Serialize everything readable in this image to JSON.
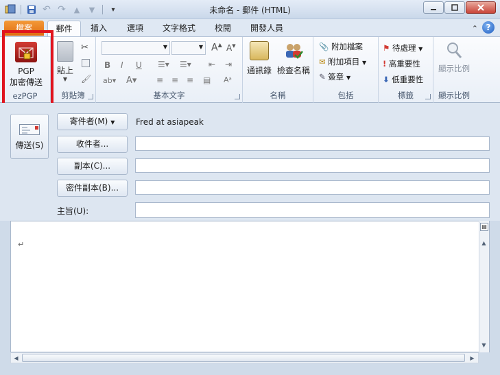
{
  "window": {
    "title": "未命名 - 郵件 (HTML)"
  },
  "tabs": {
    "file": "檔案",
    "items": [
      "郵件",
      "插入",
      "選項",
      "文字格式",
      "校閱",
      "開發人員"
    ],
    "active": "郵件"
  },
  "ribbon": {
    "ezpgp": {
      "button_line1": "PGP",
      "button_line2": "加密傳送",
      "group": "ezPGP"
    },
    "clipboard": {
      "paste": "貼上",
      "group": "剪貼簿"
    },
    "basictext": {
      "group": "基本文字"
    },
    "names": {
      "address_book": "通訊錄",
      "check_names": "檢查名稱",
      "group": "名稱"
    },
    "include": {
      "attach_file": "附加檔案",
      "attach_item": "附加項目",
      "signature": "簽章",
      "group": "包括"
    },
    "tags": {
      "follow_up": "待處理",
      "high_importance": "高重要性",
      "low_importance": "低重要性",
      "group": "標籤"
    },
    "zoom": {
      "label": "顯示比例",
      "group": "顯示比例"
    }
  },
  "compose": {
    "send": "傳送(S)",
    "from_button": "寄件者(M)",
    "from_value": "Fred at asiapeak",
    "to_button": "收件者...",
    "cc_button": "副本(C)...",
    "bcc_button": "密件副本(B)...",
    "subject_label": "主旨(U):",
    "body_cursor": "↵"
  },
  "colors": {
    "file_tab": "#e06a10",
    "highlight": "#e0141e",
    "accent": "#1f5ec2"
  }
}
